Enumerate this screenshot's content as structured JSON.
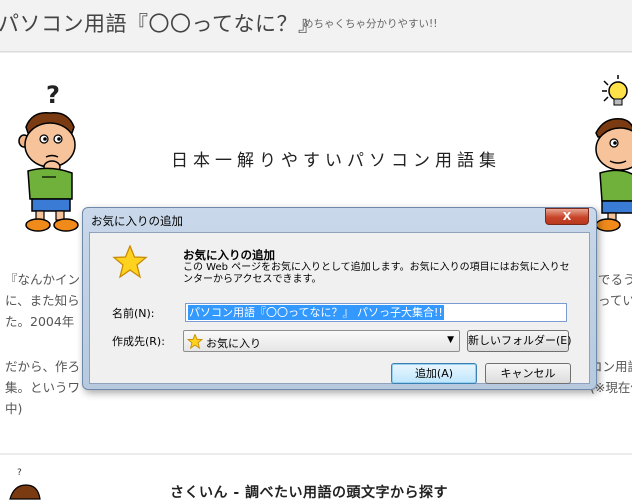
{
  "header": {
    "title": "パソコン用語『〇〇ってなに？』",
    "tagline": "めちゃくちゃ分かりやすい!!"
  },
  "main": {
    "heading": "日本一解りやすいパソコン用語集",
    "paragraph1_left": [
      "『なんかイン",
      "に、また知ら",
      "た。2004年"
    ],
    "paragraph1_right": [
      "でるう",
      "ってい",
      ""
    ],
    "paragraph2_left": [
      "だから、作ろ",
      "集。というワ",
      "中)"
    ],
    "paragraph2_right": [
      "コン用語",
      "(※現在作",
      ""
    ],
    "left_character_mark": "?",
    "index_heading": "さくいん - 調べたい用語の頭文字から探す",
    "small_mark": "?"
  },
  "dialog": {
    "title": "お気に入りの追加",
    "close_label": "X",
    "heading": "お気に入りの追加",
    "description": "この Web ページをお気に入りとして追加します。お気に入りの項目にはお気に入りセンターからアクセスできます。",
    "name_label": "名前(N):",
    "name_value": "パソコン用語『〇〇ってなに？』 パソっ子大集合!!",
    "folder_label": "作成先(R):",
    "folder_value": "お気に入り",
    "new_folder_label": "新しいフォルダー(E)",
    "add_label": "追加(A)",
    "cancel_label": "キャンセル"
  },
  "colors": {
    "accent": "#3399ff",
    "close_button": "#c8452a"
  }
}
